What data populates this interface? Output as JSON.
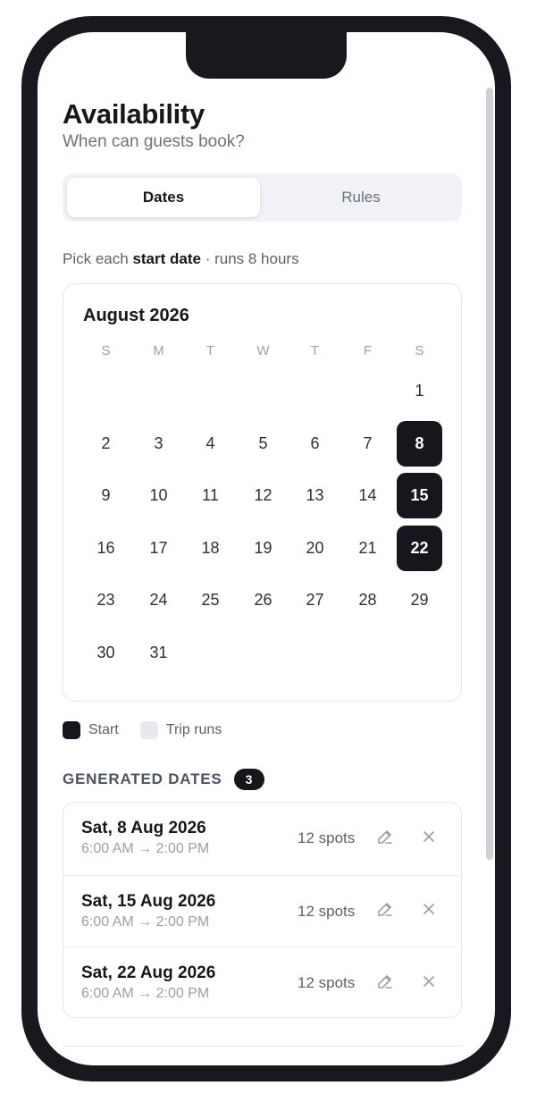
{
  "header": {
    "title": "Availability",
    "subtitle": "When can guests book?"
  },
  "tabs": [
    {
      "label": "Dates",
      "active": true
    },
    {
      "label": "Rules",
      "active": false
    }
  ],
  "hint": {
    "prefix": "Pick each ",
    "strong": "start date",
    "suffix": " · runs 8 hours"
  },
  "calendar": {
    "month_label": "August 2026",
    "weekdays": [
      "S",
      "M",
      "T",
      "W",
      "T",
      "F",
      "S"
    ],
    "first_weekday_index": 6,
    "days_in_month": 31,
    "start_days": [
      8,
      15,
      22
    ]
  },
  "legend": {
    "start_label": "Start",
    "trip_label": "Trip runs"
  },
  "generated": {
    "label": "GENERATED DATES",
    "count": "3",
    "items": [
      {
        "date": "Sat, 8 Aug 2026",
        "time": "6:00 AM → 2:00 PM",
        "spots": "12 spots"
      },
      {
        "date": "Sat, 15 Aug 2026",
        "time": "6:00 AM → 2:00 PM",
        "spots": "12 spots"
      },
      {
        "date": "Sat, 22 Aug 2026",
        "time": "6:00 AM → 2:00 PM",
        "spots": "12 spots"
      }
    ]
  },
  "colors": {
    "accent": "#15171c",
    "muted": "#6b7280",
    "border": "#e5e7eb"
  }
}
